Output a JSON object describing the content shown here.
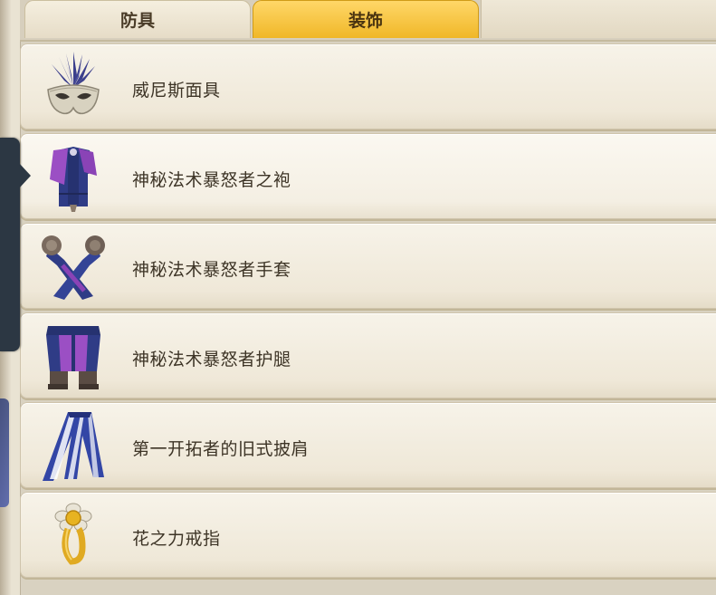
{
  "tabs": [
    {
      "label": "防具",
      "active": false
    },
    {
      "label": "装饰",
      "active": true
    }
  ],
  "colors": {
    "active_tab": "#f0b728",
    "item_background": "#f3eee2",
    "selector_handle": "#2c3743"
  },
  "items": [
    {
      "name": "威尼斯面具",
      "icon": "venetian-mask-icon"
    },
    {
      "name": "神秘法术暴怒者之袍",
      "icon": "robe-icon"
    },
    {
      "name": "神秘法术暴怒者手套",
      "icon": "gloves-icon"
    },
    {
      "name": "神秘法术暴怒者护腿",
      "icon": "leggings-icon"
    },
    {
      "name": "第一开拓者的旧式披肩",
      "icon": "shawl-icon"
    },
    {
      "name": "花之力戒指",
      "icon": "flower-ring-icon"
    }
  ],
  "selected_index": 1
}
